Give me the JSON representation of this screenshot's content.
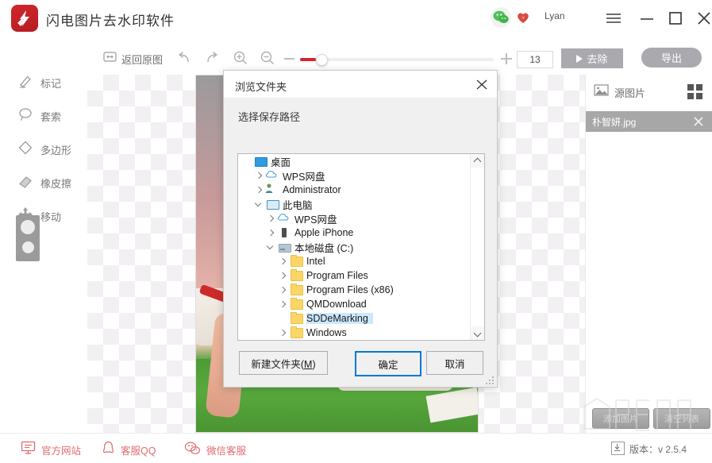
{
  "window": {
    "app_title": "闪电图片去水印软件",
    "user": "Lyan",
    "icons": {
      "logo": "lightning-eraser-logo",
      "wechat": "wechat-icon",
      "heart": "heart-icon",
      "menu": "hamburger-menu-icon",
      "minimize": "minimize-icon",
      "maximize": "maximize-icon",
      "close": "close-icon"
    }
  },
  "toolbar": {
    "revert_label": "返回原图",
    "undo": "undo-icon",
    "redo": "redo-icon",
    "zoom_in": "zoom-in-icon",
    "zoom_out": "zoom-out-icon",
    "slider_value": "13",
    "slider_percent": 8,
    "remove_label": "去除",
    "export_label": "导出"
  },
  "sidebar": {
    "tools": [
      {
        "label": "标记",
        "icon": "brush-marker-icon"
      },
      {
        "label": "套索",
        "icon": "lasso-icon"
      },
      {
        "label": "多边形",
        "icon": "polygon-icon"
      },
      {
        "label": "橡皮擦",
        "icon": "eraser-icon"
      },
      {
        "label": "移动",
        "icon": "move-icon"
      }
    ],
    "brush_size_widget": "brush-size-selector"
  },
  "right_panel": {
    "source_label": "源图片",
    "source_icon": "image-icon",
    "grid_icon": "grid-view-icon",
    "files": [
      {
        "name": "朴智妍.jpg",
        "selected": true
      }
    ],
    "buttons": [
      {
        "label": "添加图片"
      },
      {
        "label": "清空列表"
      }
    ]
  },
  "footer": {
    "links": [
      {
        "label": "官方网站",
        "icon": "monitor-icon"
      },
      {
        "label": "客服QQ",
        "icon": "qq-penguin-icon"
      },
      {
        "label": "微信客服",
        "icon": "wechat-icon"
      }
    ],
    "version": "版本：v 2.5.4",
    "version_icon": "download-icon"
  },
  "watermark": {
    "text": "www.xiazaiba.com"
  },
  "dialog": {
    "title": "浏览文件夹",
    "close_icon": "close-icon",
    "subtitle": "选择保存路径",
    "tree": [
      {
        "label": "桌面",
        "indent": 0,
        "arrow": "none",
        "icon": "desktop-icon",
        "selected": false
      },
      {
        "label": "WPS网盘",
        "indent": 1,
        "arrow": "collapsed",
        "icon": "cloud-icon",
        "selected": false
      },
      {
        "label": "Administrator",
        "indent": 1,
        "arrow": "collapsed",
        "icon": "person-icon",
        "selected": false
      },
      {
        "label": "此电脑",
        "indent": 1,
        "arrow": "expanded",
        "icon": "computer-icon",
        "selected": false
      },
      {
        "label": "WPS网盘",
        "indent": 2,
        "arrow": "collapsed",
        "icon": "cloud-icon",
        "selected": false
      },
      {
        "label": "Apple iPhone",
        "indent": 2,
        "arrow": "collapsed",
        "icon": "phone-icon",
        "selected": false
      },
      {
        "label": "本地磁盘 (C:)",
        "indent": 2,
        "arrow": "expanded",
        "icon": "drive-icon",
        "selected": false
      },
      {
        "label": "Intel",
        "indent": 3,
        "arrow": "collapsed",
        "icon": "folder-icon",
        "selected": false
      },
      {
        "label": "Program Files",
        "indent": 3,
        "arrow": "collapsed",
        "icon": "folder-icon",
        "selected": false
      },
      {
        "label": "Program Files (x86)",
        "indent": 3,
        "arrow": "collapsed",
        "icon": "folder-icon",
        "selected": false
      },
      {
        "label": "QMDownload",
        "indent": 3,
        "arrow": "collapsed",
        "icon": "folder-icon",
        "selected": false
      },
      {
        "label": "SDDeMarking",
        "indent": 3,
        "arrow": "none",
        "icon": "folder-icon",
        "selected": true
      },
      {
        "label": "Windows",
        "indent": 3,
        "arrow": "collapsed",
        "icon": "folder-icon",
        "selected": false
      }
    ],
    "buttons": {
      "new_folder": "新建文件夹(M)",
      "new_folder_accel": "M",
      "ok": "确定",
      "cancel": "取消"
    }
  },
  "colors": {
    "brand_red": "#d0262c",
    "accent_red": "#d9232a",
    "focus_blue": "#0078d7",
    "selection_blue": "#cce8ff",
    "button_gray": "#a9a9ae",
    "link_pink": "#e06b72"
  }
}
